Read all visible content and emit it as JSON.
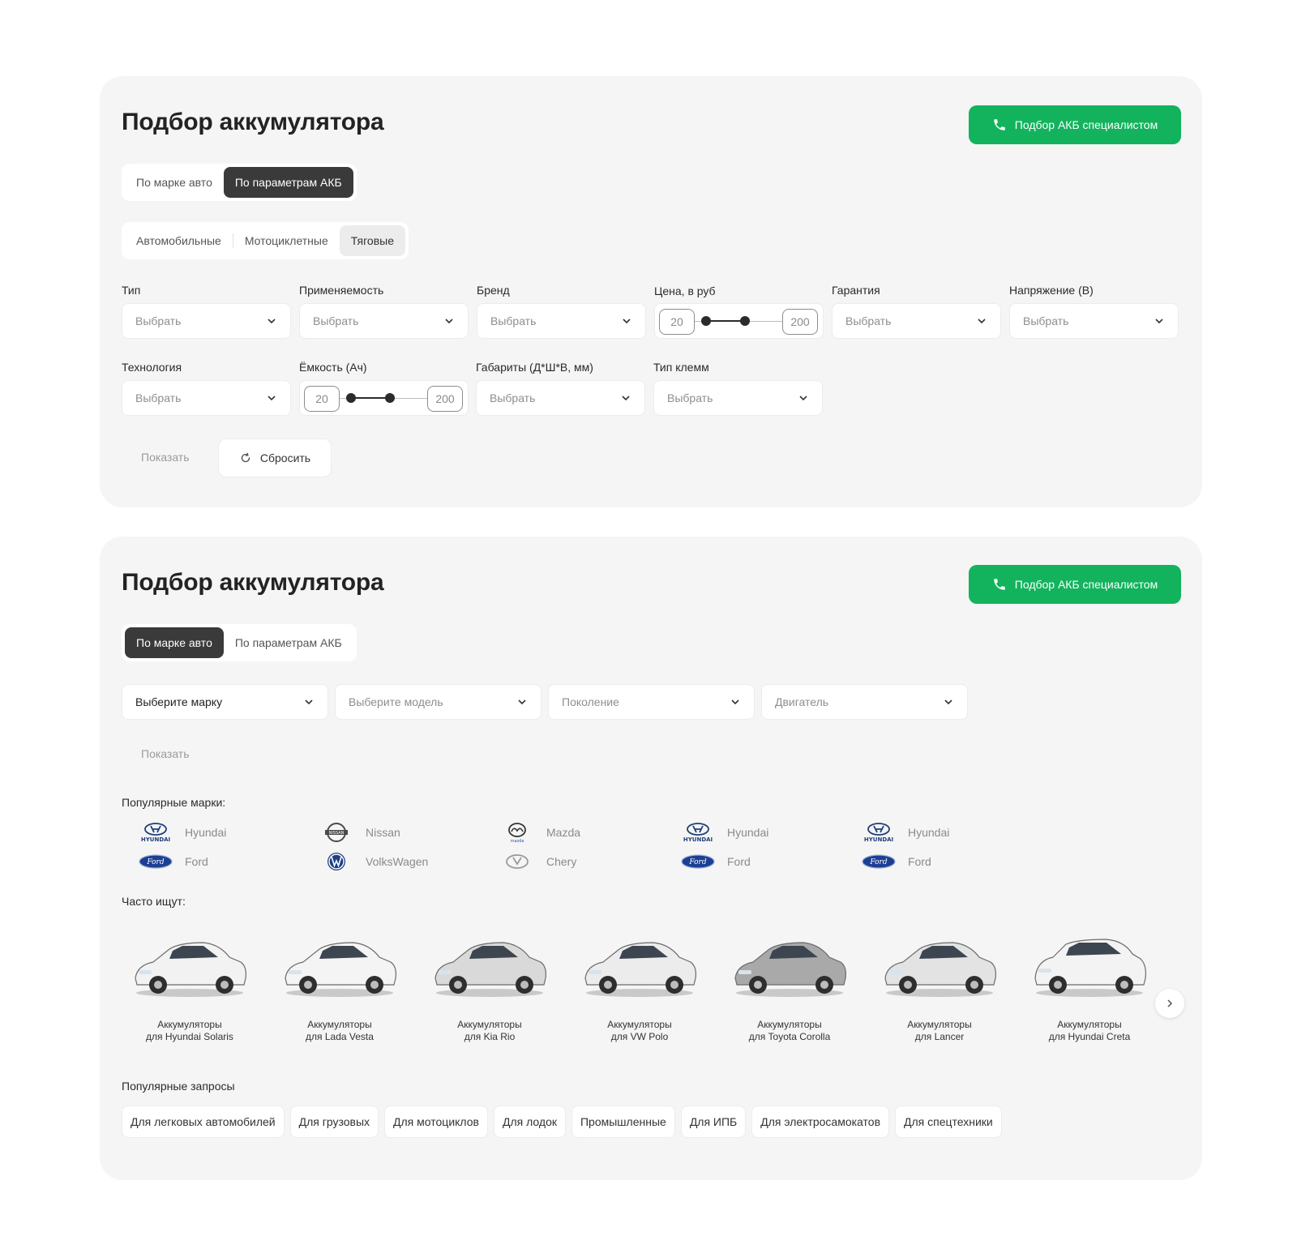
{
  "colors": {
    "accent": "#12b35c",
    "active_tab": "#3a3a3a",
    "panel_bg": "#f5f5f5"
  },
  "panel1": {
    "title": "Подбор аккумулятора",
    "cta_label": "Подбор АКБ специалистом",
    "mode_tabs": [
      {
        "label": "По марке авто",
        "active": false
      },
      {
        "label": "По параметрам АКБ",
        "active": true
      }
    ],
    "type_tabs": [
      {
        "label": "Автомобильные",
        "active": false
      },
      {
        "label": "Мотоциклетные",
        "active": false
      },
      {
        "label": "Тяговые",
        "active": true
      }
    ],
    "filters": {
      "type": {
        "label": "Тип",
        "value": "Выбрать"
      },
      "applicability": {
        "label": "Применяемость",
        "value": "Выбрать"
      },
      "brand": {
        "label": "Бренд",
        "value": "Выбрать"
      },
      "price": {
        "label": "Цена, в руб",
        "min": "20",
        "max": "200"
      },
      "warranty": {
        "label": "Гарантия",
        "value": "Выбрать"
      },
      "voltage": {
        "label": "Напряжение (В)",
        "value": "Выбрать"
      },
      "technology": {
        "label": "Технология",
        "value": "Выбрать"
      },
      "capacity": {
        "label": "Ёмкость (Ач)",
        "min": "20",
        "max": "200"
      },
      "dimensions": {
        "label": "Габариты (Д*Ш*В, мм)",
        "value": "Выбрать"
      },
      "terminal": {
        "label": "Тип клемм",
        "value": "Выбрать"
      }
    },
    "show_label": "Показать",
    "reset_label": "Сбросить"
  },
  "panel2": {
    "title": "Подбор аккумулятора",
    "cta_label": "Подбор АКБ специалистом",
    "mode_tabs": [
      {
        "label": "По марке авто",
        "active": true
      },
      {
        "label": "По параметрам АКБ",
        "active": false
      }
    ],
    "selects": [
      {
        "value": "Выберите марку",
        "selected": true
      },
      {
        "value": "Выберите модель",
        "selected": false
      },
      {
        "value": "Поколение",
        "selected": false
      },
      {
        "value": "Двигатель",
        "selected": false
      }
    ],
    "show_label": "Показать",
    "popular_brands_title": "Популярные марки:",
    "brands": [
      {
        "name": "Hyundai",
        "icon": "hyundai-logo"
      },
      {
        "name": "Nissan",
        "icon": "nissan-logo"
      },
      {
        "name": "Mazda",
        "icon": "mazda-logo"
      },
      {
        "name": "Hyundai",
        "icon": "hyundai-logo"
      },
      {
        "name": "Hyundai",
        "icon": "hyundai-logo"
      },
      {
        "name": "Ford",
        "icon": "ford-logo"
      },
      {
        "name": "VolksWagen",
        "icon": "volkswagen-logo"
      },
      {
        "name": "Chery",
        "icon": "chery-logo"
      },
      {
        "name": "Ford",
        "icon": "ford-logo"
      },
      {
        "name": "Ford",
        "icon": "ford-logo"
      }
    ],
    "frequent_title": "Часто ищут:",
    "cars": [
      {
        "line1": "Аккумуляторы",
        "line2": "для Hyundai Solaris",
        "color": "#f2f2f2"
      },
      {
        "line1": "Аккумуляторы",
        "line2": "для Lada Vesta",
        "color": "#f4f4f4"
      },
      {
        "line1": "Аккумуляторы",
        "line2": "для Kia Rio",
        "color": "#d9d9d9"
      },
      {
        "line1": "Аккумуляторы",
        "line2": "для VW Polo",
        "color": "#ececec"
      },
      {
        "line1": "Аккумуляторы",
        "line2": "для Toyota Corolla",
        "color": "#a9a9a9"
      },
      {
        "line1": "Аккумуляторы",
        "line2": "для Lancer",
        "color": "#e3e3e3"
      },
      {
        "line1": "Аккумуляторы",
        "line2": "для Hyundai Creta",
        "color": "#f3f3f3"
      }
    ],
    "popular_queries_title": "Популярные запросы",
    "queries": [
      "Для легковых автомобилей",
      "Для грузовых",
      "Для мотоциклов",
      "Для лодок",
      "Промышленные",
      "Для ИПБ",
      "Для электросамокатов",
      "Для спецтехники"
    ]
  }
}
